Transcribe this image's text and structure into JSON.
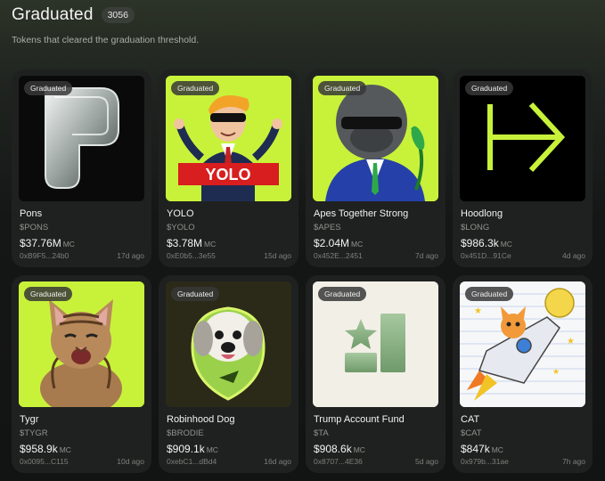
{
  "header": {
    "title": "Graduated",
    "count": "3056",
    "subtitle": "Tokens that cleared the graduation threshold."
  },
  "mc_label": "MC",
  "badge_label": "Graduated",
  "colors": {
    "lime": "#c8f23a",
    "card_bg": "#1f2120",
    "page_bg": "#141615"
  },
  "tokens": [
    {
      "name": "Pons",
      "ticker": "$PONS",
      "market_cap": "$37.76M",
      "address": "0xB9F5...24b0",
      "age": "17d ago",
      "icon": "glass-p-logo"
    },
    {
      "name": "YOLO",
      "ticker": "$YOLO",
      "market_cap": "$3.78M",
      "address": "0xE0b5...3e55",
      "age": "15d ago",
      "icon": "yolo-man-logo",
      "banner": "YOLO"
    },
    {
      "name": "Apes Together Strong",
      "ticker": "$APES",
      "market_cap": "$2.04M",
      "address": "0x452E...2451",
      "age": "7d ago",
      "icon": "ape-suit-logo"
    },
    {
      "name": "Hoodlong",
      "ticker": "$LONG",
      "market_cap": "$986.3k",
      "address": "0x451D...91Ce",
      "age": "4d ago",
      "icon": "arrow-bar-logo"
    },
    {
      "name": "Tygr",
      "ticker": "$TYGR",
      "market_cap": "$958.9k",
      "address": "0x0095...C115",
      "age": "10d ago",
      "icon": "kitten-logo"
    },
    {
      "name": "Robinhood Dog",
      "ticker": "$BRODIE",
      "market_cap": "$909.1k",
      "address": "0xebC1...dBd4",
      "age": "16d ago",
      "icon": "dog-logo"
    },
    {
      "name": "Trump Account Fund",
      "ticker": "$TA",
      "market_cap": "$908.6k",
      "address": "0x8707...4E36",
      "age": "5d ago",
      "icon": "star-bars-logo"
    },
    {
      "name": "CAT",
      "ticker": "$CAT",
      "market_cap": "$847k",
      "address": "0x979b...31ae",
      "age": "7h ago",
      "icon": "rocket-cat-logo"
    }
  ]
}
